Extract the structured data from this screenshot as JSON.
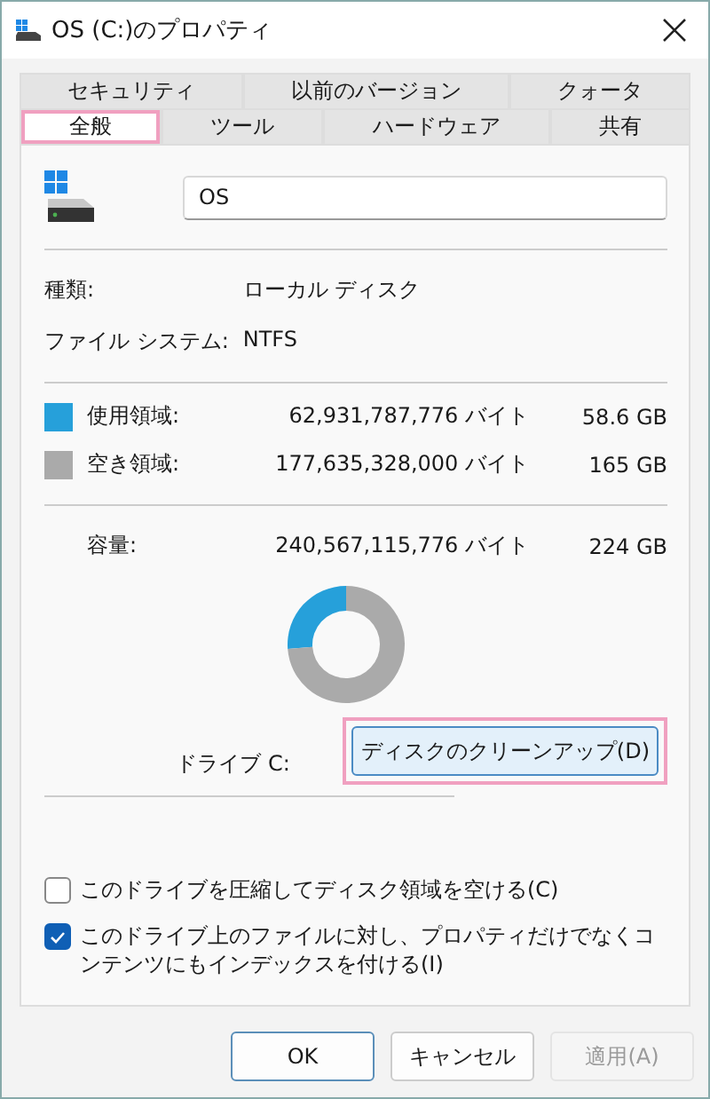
{
  "window": {
    "title": "OS (C:)のプロパティ"
  },
  "tab_rows": [
    [
      {
        "label": "セキュリティ",
        "selected": false,
        "highlighted": false
      },
      {
        "label": "以前のバージョン",
        "selected": false,
        "highlighted": false
      },
      {
        "label": "クォータ",
        "selected": false,
        "highlighted": false
      }
    ],
    [
      {
        "label": "全般",
        "selected": true,
        "highlighted": true
      },
      {
        "label": "ツール",
        "selected": false,
        "highlighted": false
      },
      {
        "label": "ハードウェア",
        "selected": false,
        "highlighted": false
      },
      {
        "label": "共有",
        "selected": false,
        "highlighted": false
      }
    ]
  ],
  "name_field": {
    "value": "OS"
  },
  "info": [
    {
      "label": "種類:",
      "value": "ローカル ディスク"
    },
    {
      "label": "ファイル システム:",
      "value": "NTFS"
    }
  ],
  "space": [
    {
      "label": "使用領域:",
      "bytes": "62,931,787,776 バイト",
      "size": "58.6 GB",
      "color": "#26a0da"
    },
    {
      "label": "空き領域:",
      "bytes": "177,635,328,000 バイト",
      "size": "165 GB",
      "color": "#aaaaaa"
    }
  ],
  "capacity": {
    "label": "容量:",
    "bytes": "240,567,115,776 バイト",
    "size": "224 GB"
  },
  "chart_data": {
    "type": "donut",
    "values": [
      26.2,
      73.8
    ]
  },
  "drive_label": "ドライブ C:",
  "cleanup_button": {
    "label": "ディスクのクリーンアップ(D)",
    "highlighted": true
  },
  "options": [
    {
      "label": "このドライブを圧縮してディスク領域を空ける(C)",
      "checked": false
    },
    {
      "label": "このドライブ上のファイルに対し、プロパティだけでなくコンテンツにもインデックスを付ける(I)",
      "checked": true
    }
  ],
  "buttons": [
    {
      "label": "OK",
      "disabled": false,
      "default": true
    },
    {
      "label": "キャンセル",
      "disabled": false,
      "default": false
    },
    {
      "label": "適用(A)",
      "disabled": true,
      "default": false
    }
  ]
}
